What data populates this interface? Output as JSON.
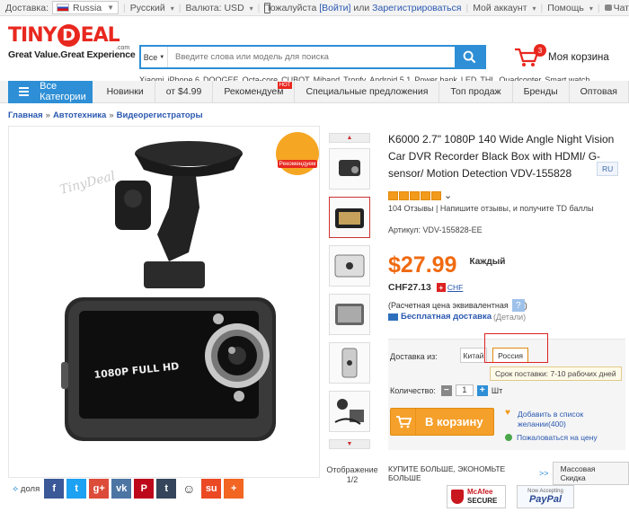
{
  "topbar": {
    "delivery_label": "Доставка:",
    "country": "Russia",
    "language": "Русский",
    "currency_label": "Валюта: USD",
    "complain": "Пожалуйста",
    "login": "[Войти]",
    "or": "или",
    "register": "Зарегистрироваться",
    "account": "Мой аккаунт",
    "help": "Помощь",
    "chat": "Чат"
  },
  "header": {
    "logo_letters": [
      "T",
      "I",
      "N",
      "Y",
      "D",
      "E",
      "A",
      "L"
    ],
    "logo_com": ".com",
    "tagline": "Great Value.Great Experience",
    "search_category": "Все",
    "search_placeholder": "Введите слова или модель для поиска",
    "hotwords": [
      "Xiaomi",
      "iPhone 6",
      "DOOGEE",
      "Octa-core",
      "CUBOT",
      "Miband",
      "Tronfy",
      "Android 5.1",
      "Power bank",
      "LED",
      "THL",
      "Quadcopter",
      "Smart watch"
    ],
    "cart_count": "3",
    "cart_label": "Моя корзина"
  },
  "nav": {
    "all_categories": "Все Категории",
    "items": [
      "Новинки",
      "от $4.99",
      "Рекомендуем",
      "Специальные предложения",
      "Топ продаж",
      "Бренды",
      "Оптовая"
    ],
    "hot_label": "HOT"
  },
  "breadcrumbs": [
    "Главная",
    "Автотехника",
    "Видеорегистраторы"
  ],
  "gallery": {
    "recommend_label": "Рекомендуем",
    "watermark": "TinyDeal",
    "screen_text": "1080P FULL HD",
    "display_label": "Отображение",
    "display_pages": "1/2",
    "share_label": "доля",
    "share_icons": [
      "f",
      "t",
      "g+",
      "vk",
      "P",
      "t",
      "reddit",
      "su",
      "+"
    ]
  },
  "product": {
    "title": "K6000 2.7\" 1080P 140 Wide Angle Night Vision Car DVR Recorder Black Box with HDMI/ G-sensor/ Motion Detection VDV-155828",
    "lang_badge": "RU",
    "rating_stars": 5,
    "reviews": "104 Отзывы",
    "sep": "|",
    "write_review": "Напишите отзывы, и получите TD баллы",
    "article": "Артикул: VDV-155828-EE",
    "price": "$27.99",
    "per": "Каждый",
    "price_chf": "CHF27.13",
    "chf_code": "CHF",
    "equivalent": "(Расчетная цена эквивалентная",
    "question": "?",
    "close_paren": ")",
    "free_shipping": "Бесплатная доставка",
    "details": "(Детали)",
    "ship_from_label": "Доставка из:",
    "ship_from_options": [
      "Китай",
      "Россия"
    ],
    "delivery_time": "Срок поставки: 7-10 рабочих дней",
    "quantity_label": "Количество:",
    "quantity_value": "1",
    "quantity_unit": "Шт",
    "add_to_cart": "В корзину",
    "wishlist": "Добавить в список желании(400)",
    "price_alert": "Пожаловаться на цену",
    "buy_more": "КУПИТЕ БОЛЬШЕ, ЭКОНОМЬТЕ БОЛЬШЕ",
    "buy_more_arrow": ">>",
    "bulk_discount": "Массовая Скидка",
    "mcafee_top": "McAfee",
    "mcafee_bottom": "SECURE",
    "paypal_top": "Now Accepting",
    "paypal": "PayPal"
  }
}
